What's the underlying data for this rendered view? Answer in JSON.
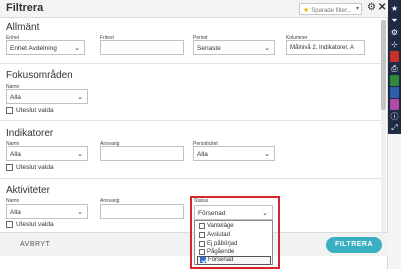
{
  "dialog": {
    "title": "Filtrera",
    "saved_filters_placeholder": "Sparade filter...",
    "cancel_label": "AVBRYT",
    "apply_label": "FILTRERA"
  },
  "sections": {
    "general": {
      "title": "Allmänt",
      "labels": {
        "unit": "Enhet",
        "free_text": "Fritext",
        "period": "Period",
        "columns": "Kolumner"
      },
      "values": {
        "unit": "Enhet Avdelning",
        "free_text": "",
        "period": "Senaste",
        "columns": "Målnivå 2, Indikatorer, A"
      }
    },
    "focus_areas": {
      "title": "Fokusområden",
      "labels": {
        "name": "Namn"
      },
      "values": {
        "name": "Alla"
      },
      "exclude_label": "Uteslut valda"
    },
    "indicators": {
      "title": "Indikatorer",
      "labels": {
        "name": "Namn",
        "manager": "Ansvarig",
        "periodicity": "Periodicitet"
      },
      "values": {
        "name": "Alla",
        "manager": "",
        "periodicity": "Alla"
      },
      "exclude_label": "Uteslut valda"
    },
    "activities": {
      "title": "Aktiviteter",
      "labels": {
        "name": "Namn",
        "manager": "Ansvarig",
        "status": "Status"
      },
      "values": {
        "name": "Alla",
        "manager": "",
        "status": "Försenad"
      },
      "exclude_label": "Uteslut valda",
      "status_options": [
        {
          "label": "Vanteläge",
          "checked": false
        },
        {
          "label": "Avslutad",
          "checked": false
        },
        {
          "label": "Ej påbörjad",
          "checked": false
        },
        {
          "label": "Pågående",
          "checked": false
        },
        {
          "label": "Försenad",
          "checked": true
        }
      ]
    }
  },
  "toolbar_icons": [
    "star-icon",
    "funnel-icon",
    "gear-icon",
    "hierarchy-icon",
    "pdf-icon",
    "print-icon",
    "excel-icon",
    "word-icon",
    "presentation-icon",
    "info-icon",
    "expand-icon"
  ],
  "colors": {
    "accent": "#3aafc2",
    "highlight": "#d7262b",
    "toolbar_bg": "#1f2a44"
  }
}
